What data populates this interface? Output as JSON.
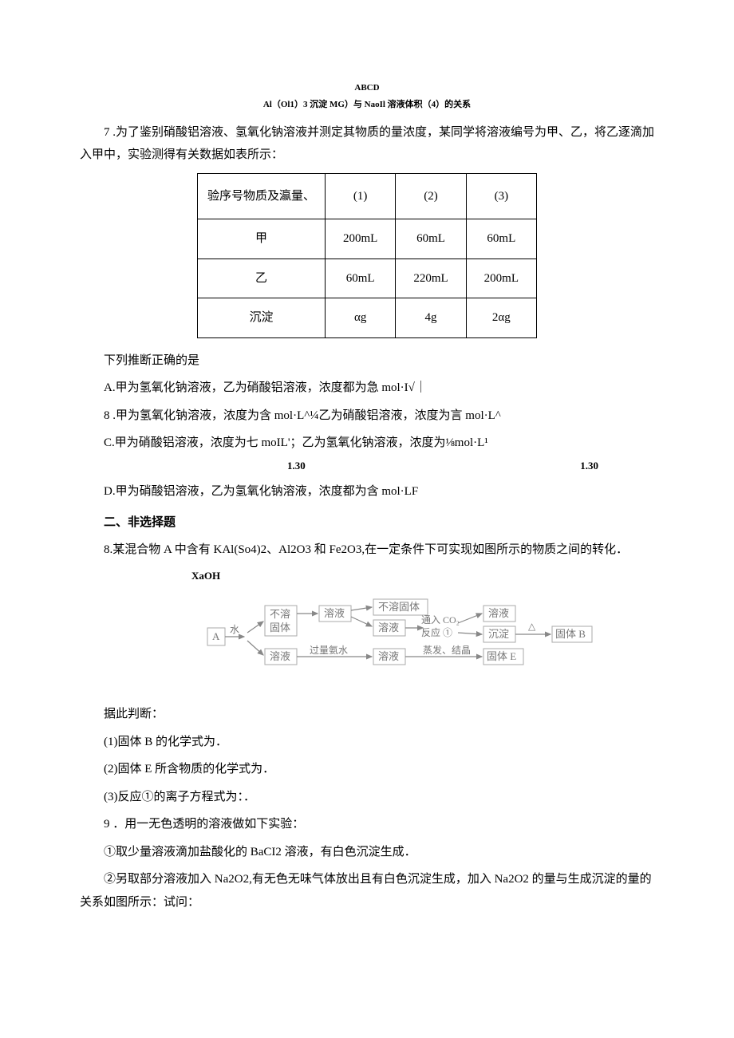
{
  "header": {
    "abcd": "ABCD",
    "rel": "Al（Ol1）3 沉淀 MG）与 NaoIl 溶液体积（4）的关系"
  },
  "q7": {
    "stem": "7 .为了鉴别硝酸铝溶液、氢氧化钠溶液并测定其物质的量浓度，某同学将溶液编号为甲、乙，将乙逐滴加入甲中，实验测得有关数据如表所示：",
    "table": {
      "r1c1": "验序号物质及瀛量、",
      "c1": "(1)",
      "c2": "(2)",
      "c3": "(3)",
      "r2c1": "甲",
      "r2c2": "200mL",
      "r2c3": "60mL",
      "r2c4": "60mL",
      "r3c1": "乙",
      "r3c2": "60mL",
      "r3c3": "220mL",
      "r3c4": "200mL",
      "r4c1": "沉淀",
      "r4c2": "αg",
      "r4c3": "4g",
      "r4c4": "2αg"
    },
    "lead": "下列推断正确的是",
    "optA": "A.甲为氢氧化钠溶液，乙为硝酸铝溶液，浓度都为急 mol·I√｜",
    "optB": "8 .甲为氢氧化钠溶液，浓度为含 mol·L^¼乙为硝酸铝溶液，浓度为言 mol·L^",
    "optC": "C.甲为硝酸铝溶液，浓度为七 moIL'；乙为氢氧化钠溶液，浓度为⅛mol·L¹",
    "midL": "1.30",
    "midR": "1.30",
    "optD": "D.甲为硝酸铝溶液，乙为氢氧化钠溶液，浓度都为含 mol·LF"
  },
  "sec2": "二、非选择题",
  "q8": {
    "stem": "8.某混合物 A 中含有 KAl(So4)2、Al2O3 和 Fe2O3,在一定条件下可实现如图所示的物质之间的转化．",
    "naoh": "XaOH",
    "diagram": {
      "A": "A",
      "water": "水",
      "b1a": "不溶",
      "b1b": "固体",
      "b2": "溶液",
      "arr1": "过量氨水",
      "b3": "溶液",
      "b4": "溶液",
      "b5": "不溶固体",
      "b6": "溶液",
      "arr2a": "通入 CO₂",
      "arr2b": "反应 ①",
      "b7": "溶液",
      "b8": "沉淀",
      "tri": "△",
      "b9": "固体 B",
      "arr3": "蒸发、结晶",
      "b10": "固体 E"
    },
    "tail": "据此判断：",
    "p1": "(1)固体 B 的化学式为．",
    "p2": "(2)固体 E 所含物质的化学式为．",
    "p3": "(3)反应①的离子方程式为：．"
  },
  "q9": {
    "stem": "9 ．用一无色透明的溶液做如下实验：",
    "p1": "①取少量溶液滴加盐酸化的 BaCI2 溶液，有白色沉淀生成．",
    "p2": "②另取部分溶液加入 Na2O2,有无色无味气体放出且有白色沉淀生成，加入 Na2O2 的量与生成沉淀的量的关系如图所示：试问："
  }
}
